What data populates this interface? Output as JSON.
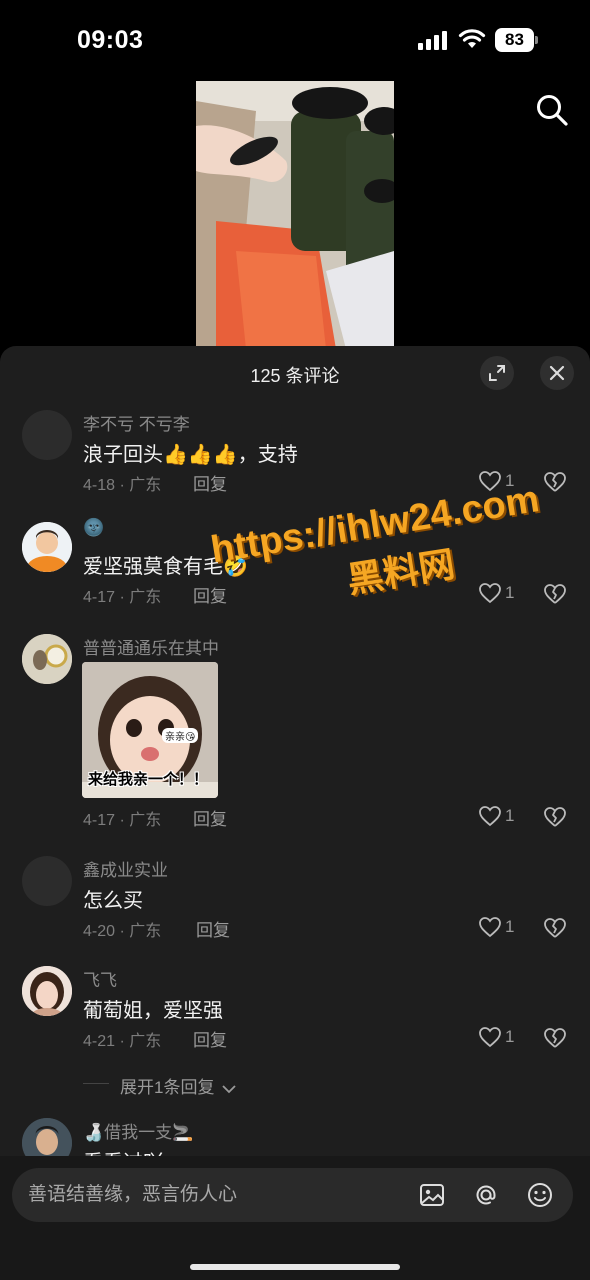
{
  "status_bar": {
    "time": "09:03",
    "battery": "83"
  },
  "comments_panel": {
    "title": "125 条评论"
  },
  "comments": [
    {
      "username": "李不亏 不亏李",
      "text": "浪子回头👍👍👍，支持",
      "date": "4-18",
      "location": "广东",
      "reply_label": "回复",
      "likes": "1"
    },
    {
      "username": "🌚",
      "text": "爱坚强莫食有毛🤣",
      "date": "4-17",
      "location": "广东",
      "reply_label": "回复",
      "likes": "1"
    },
    {
      "username": "普普通通乐在其中",
      "sticker_caption": "来给我亲一个！！",
      "sticker_tag": "亲亲😘",
      "date": "4-17",
      "location": "广东",
      "reply_label": "回复",
      "likes": "1"
    },
    {
      "username": "鑫成业实业",
      "text": "怎么买",
      "date": "4-20",
      "location": "广东",
      "reply_label": "回复",
      "likes": "1"
    },
    {
      "username": "飞飞",
      "text": "葡萄姐，爱坚强",
      "date": "4-21",
      "location": "广东",
      "reply_label": "回复",
      "likes": "1"
    },
    {
      "username": "🍶借我一支🚬",
      "text": "看看过吖"
    }
  ],
  "expand_replies": "展开1条回复",
  "watermark": {
    "url": "https://ihlw24.com",
    "name": "黑料网"
  },
  "input": {
    "placeholder": "善语结善缘，恶言伤人心"
  },
  "icons": {
    "search": "search-icon",
    "expand": "expand-icon",
    "close": "close-icon",
    "like": "heart-icon",
    "dislike": "broken-heart-icon",
    "image": "image-icon",
    "mention": "at-icon",
    "emoji": "emoji-icon"
  },
  "colors": {
    "sheet_bg": "#1e1e1e",
    "watermark": "#f5a623"
  }
}
